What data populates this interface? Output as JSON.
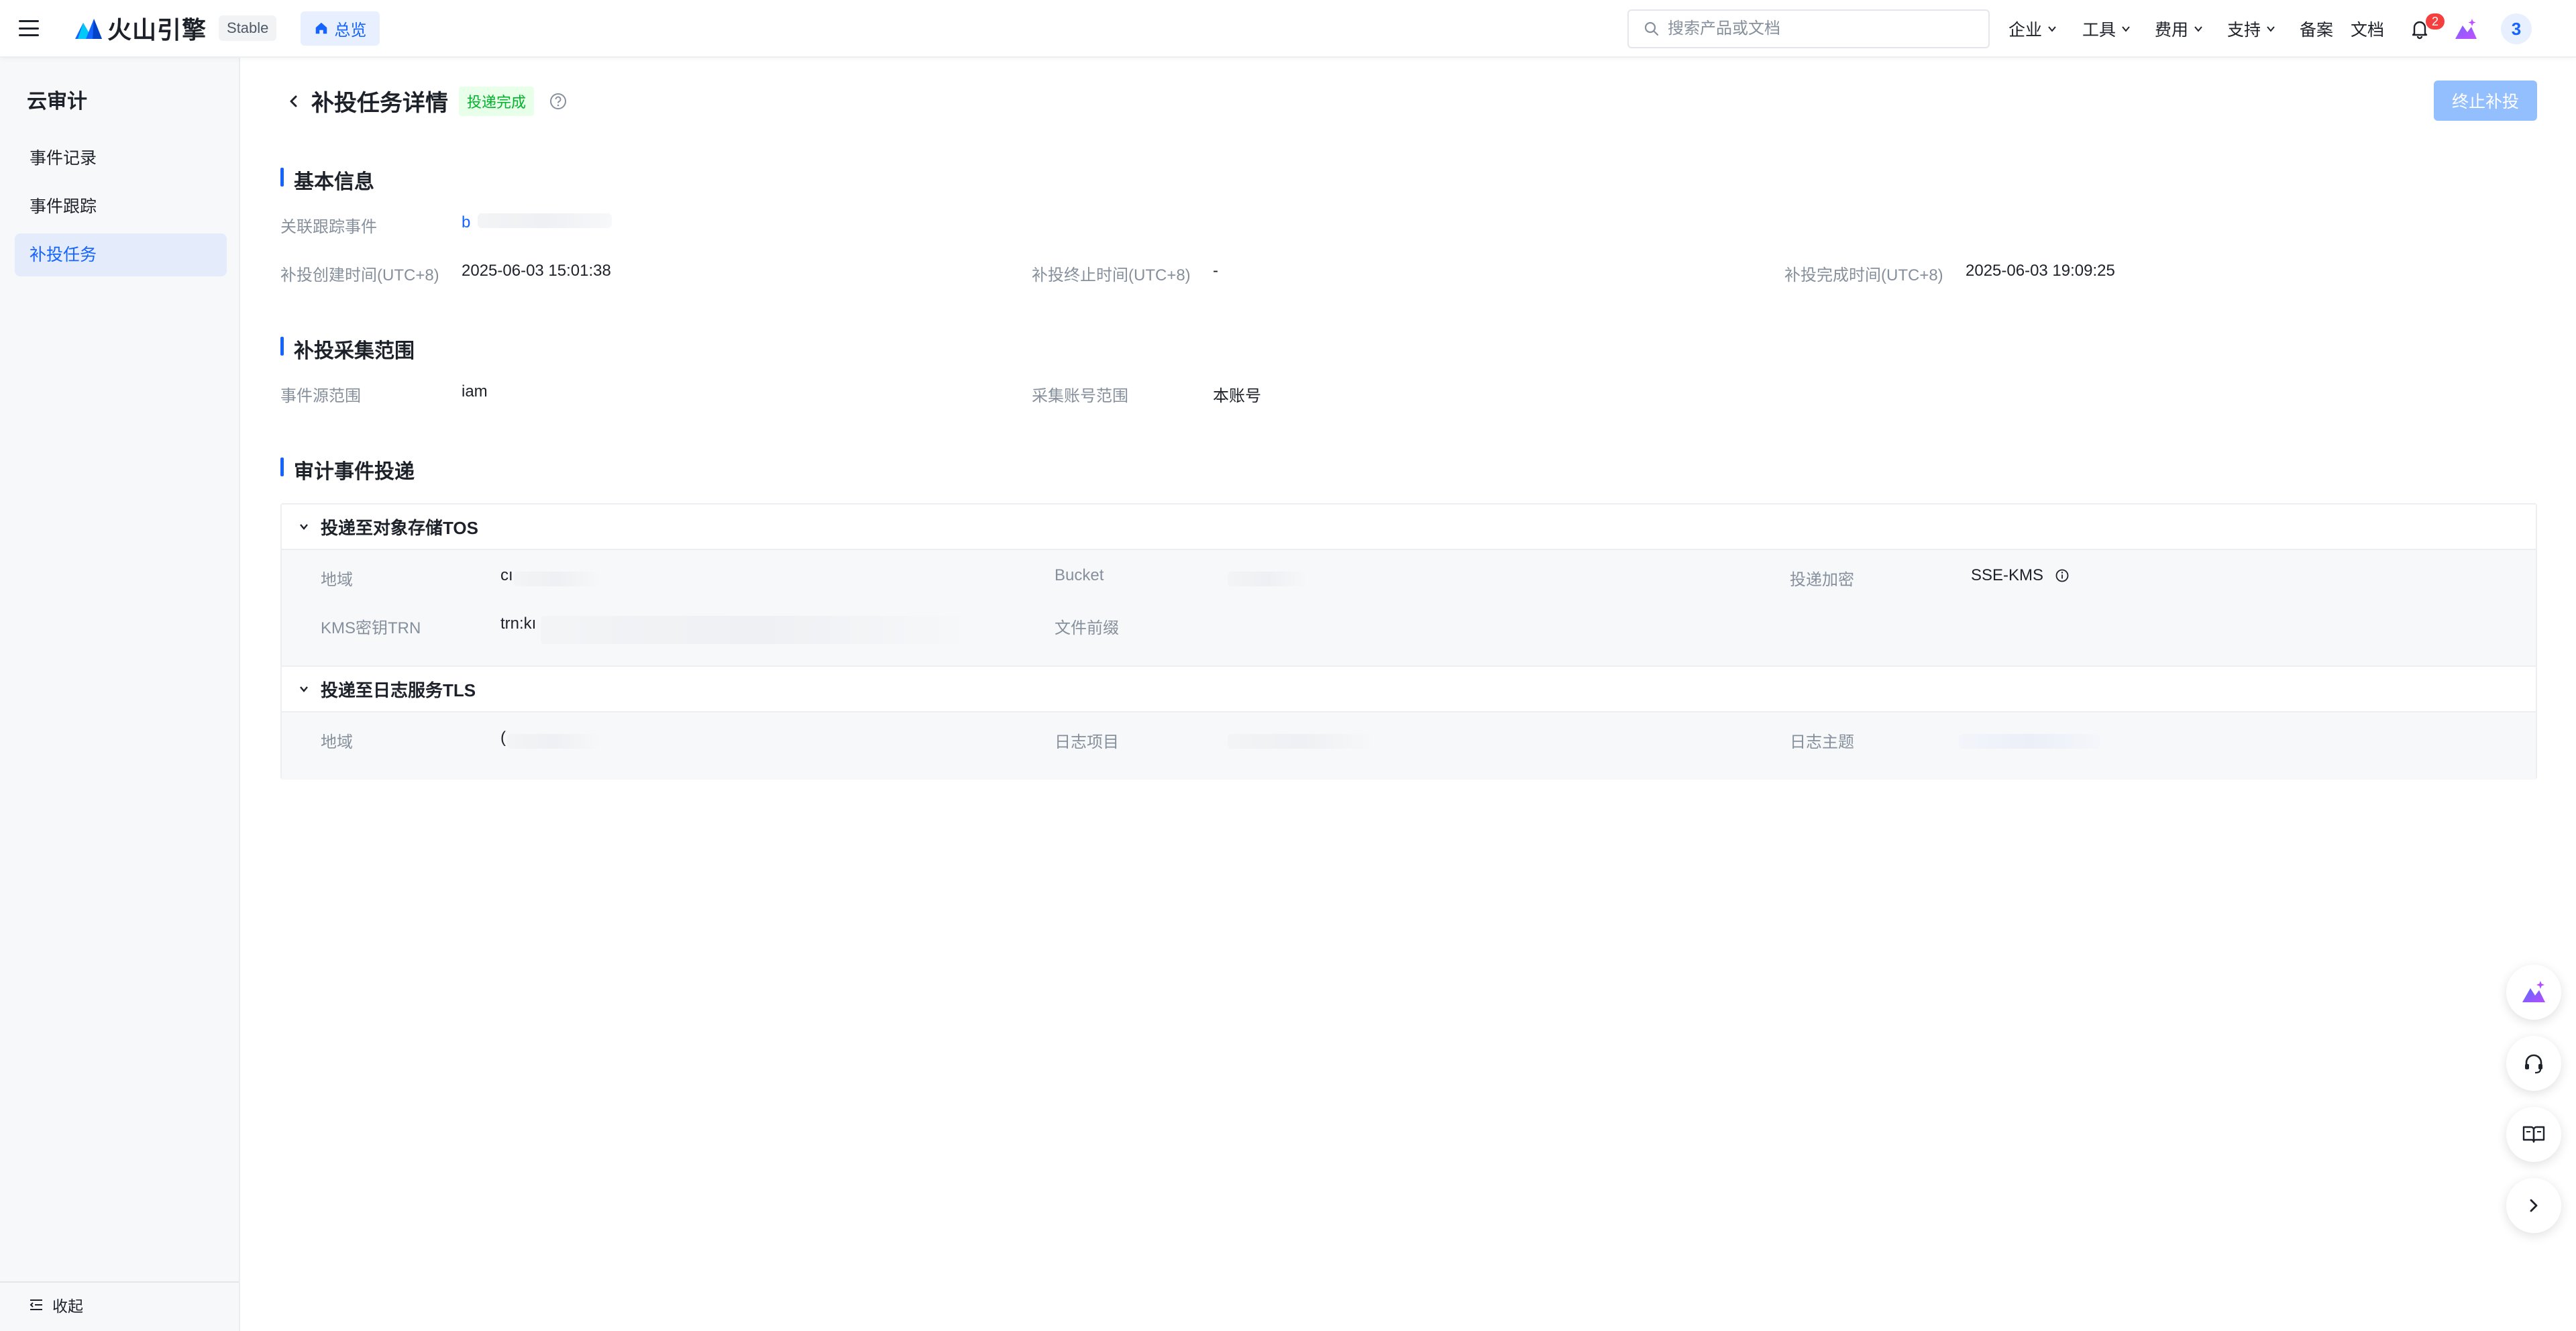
{
  "topbar": {
    "brand": "火山引擎",
    "env_tag": "Stable",
    "home_tab": "总览",
    "search_placeholder": "搜索产品或文档",
    "menu": [
      {
        "label": "企业"
      },
      {
        "label": "工具"
      },
      {
        "label": "费用"
      },
      {
        "label": "支持"
      }
    ],
    "beian": "备案",
    "docs": "文档",
    "notification_count": "2",
    "avatar_text": "3"
  },
  "sidebar": {
    "title": "云审计",
    "items": [
      {
        "label": "事件记录"
      },
      {
        "label": "事件跟踪"
      },
      {
        "label": "补投任务"
      }
    ],
    "collapse_label": "收起"
  },
  "page": {
    "title": "补投任务详情",
    "status": "投递完成",
    "stop_button": "终止补投"
  },
  "basic_info": {
    "title": "基本信息",
    "trail_label": "关联跟踪事件",
    "trail_value": "b",
    "created_label": "补投创建时间(UTC+8)",
    "created_value": "2025-06-03 15:01:38",
    "terminated_label": "补投终止时间(UTC+8)",
    "terminated_value": "-",
    "completed_label": "补投完成时间(UTC+8)",
    "completed_value": "2025-06-03 19:09:25"
  },
  "scope": {
    "title": "补投采集范围",
    "source_label": "事件源范围",
    "source_value": "iam",
    "account_label": "采集账号范围",
    "account_value": "本账号"
  },
  "delivery": {
    "title": "审计事件投递",
    "tos": {
      "title": "投递至对象存储TOS",
      "region_label": "地域",
      "region_value": "cı",
      "bucket_label": "Bucket",
      "encrypt_label": "投递加密",
      "encrypt_value": "SSE-KMS",
      "kms_label": "KMS密钥TRN",
      "kms_value": "trn:kı",
      "prefix_label": "文件前缀"
    },
    "tls": {
      "title": "投递至日志服务TLS",
      "region_label": "地域",
      "region_value": "(",
      "project_label": "日志项目",
      "topic_label": "日志主题"
    }
  },
  "colors": {
    "primary": "#1664ff",
    "success": "#00b42a",
    "disabled_button": "#94bfff",
    "badge": "#f53f3f"
  }
}
